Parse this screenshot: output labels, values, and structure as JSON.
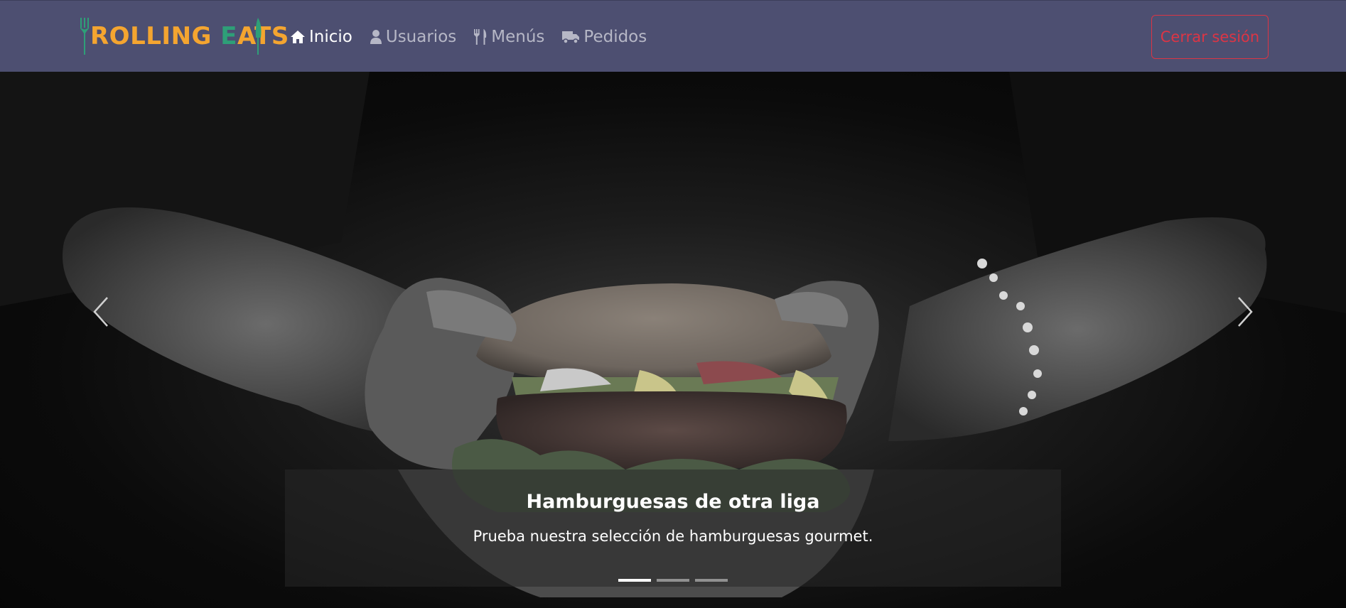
{
  "brand": {
    "logo_text_1": "ROLLING ",
    "logo_text_e": "E",
    "logo_text_2": "ATS",
    "primary_color": "#f4a530",
    "accent_color": "#2e9f78"
  },
  "navbar": {
    "background": "#4d4f71",
    "items": [
      {
        "label": "Inicio",
        "icon": "home-icon",
        "active": true
      },
      {
        "label": "Usuarios",
        "icon": "user-icon",
        "active": false
      },
      {
        "label": "Menús",
        "icon": "utensils-icon",
        "active": false
      },
      {
        "label": "Pedidos",
        "icon": "truck-icon",
        "active": false
      }
    ],
    "logout_label": "Cerrar sesión",
    "logout_color": "#dc3545"
  },
  "carousel": {
    "slides": [
      {
        "title": "Hamburguesas de otra liga",
        "text": "Prueba nuestra selección de hamburguesas gourmet.",
        "image": "hands-holding-burger"
      }
    ],
    "active_index": 0,
    "indicator_count": 3,
    "prev_icon": "chevron-left-icon",
    "next_icon": "chevron-right-icon"
  }
}
